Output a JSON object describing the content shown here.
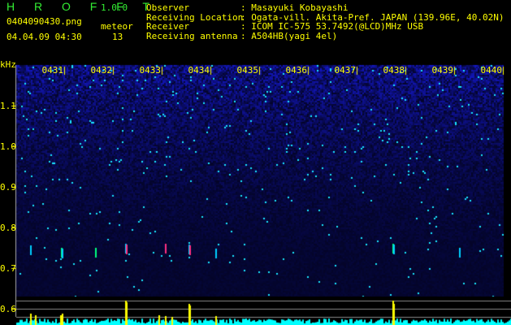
{
  "header": {
    "app_name": "H R O F F T",
    "version": "1.0.0",
    "filename": "0404090430.png",
    "datetime": "04.04.09 04:30",
    "meteor_label": "meteor",
    "meteor_count": "13"
  },
  "info": [
    {
      "label": "Observer",
      "value": ": Masayuki Kobayashi"
    },
    {
      "label": "Receiving Location",
      "value": ": Ogata-vill. Akita-Pref. JAPAN (139.96E, 40.02N)"
    },
    {
      "label": "Receiver",
      "value": ": ICOM IC-575 53.7492(@LCD)MHz USB"
    },
    {
      "label": "Receiving antenna",
      "value": ": A504HB(yagi 4el)"
    }
  ],
  "axis": {
    "unit": "kHz",
    "time_labels": [
      "0431",
      "0432",
      "0433",
      "0434",
      "0435",
      "0436",
      "0437",
      "0438",
      "0439",
      "0440"
    ],
    "freq_labels": [
      "1.1",
      "1.0",
      "0.9",
      "0.8",
      "0.7",
      "0.6"
    ]
  },
  "colors": {
    "text": "#ffff00",
    "logo": "#33ee33",
    "background_noise": "#1020a0",
    "histogram": "#00ffff",
    "meteor_bar": "#ffff00"
  }
}
